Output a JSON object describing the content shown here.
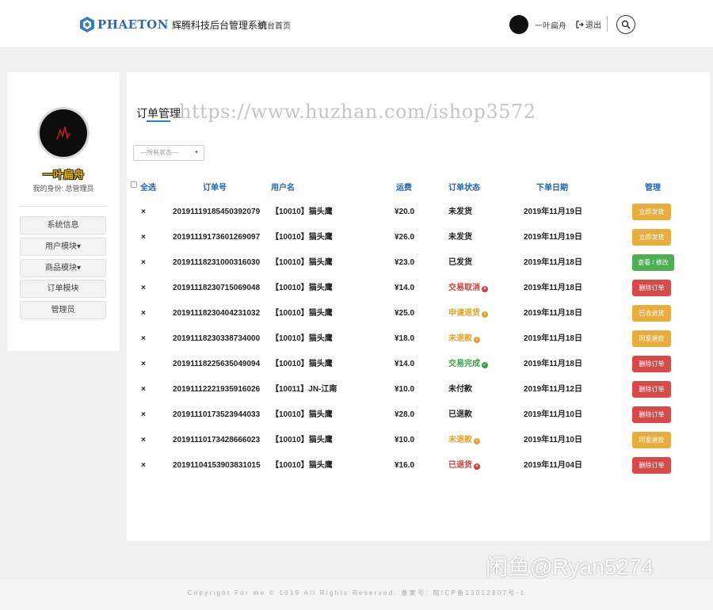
{
  "header": {
    "brand": "PHAETON",
    "system_name": "辉腾科技后台管理系统",
    "nav_home": "前台首页",
    "username": "一叶扁舟",
    "logout": "退出"
  },
  "sidebar": {
    "name": "一叶扁舟",
    "role": "我的身份: 总管理员",
    "items": [
      {
        "label": "系统信息"
      },
      {
        "label": "用户模块▾"
      },
      {
        "label": "商品模块▾"
      },
      {
        "label": "订单模块"
      },
      {
        "label": "管理员"
      }
    ]
  },
  "main": {
    "title": "订单管理",
    "watermark": "https://www.huzhan.com/ishop3572",
    "status_select": "—所有状态—",
    "columns": {
      "select_all": "全选",
      "order_no": "订单号",
      "user": "用户名",
      "shipping": "运费",
      "status": "订单状态",
      "date": "下单日期",
      "manage": "管理"
    },
    "rows": [
      {
        "del": "×",
        "order_no": "20191119185450392079",
        "user": "【10010】猫头鹰",
        "shipping": "¥20.0",
        "status": "未发货",
        "status_color": "#222222",
        "status_icon": "",
        "date": "2019年11月19日",
        "action": "立即发货",
        "action_type": "orange"
      },
      {
        "del": "×",
        "order_no": "20191119173601269097",
        "user": "【10010】猫头鹰",
        "shipping": "¥26.0",
        "status": "未发货",
        "status_color": "#222222",
        "status_icon": "",
        "date": "2019年11月19日",
        "action": "立即发货",
        "action_type": "orange"
      },
      {
        "del": "×",
        "order_no": "20191118231000316030",
        "user": "【10010】猫头鹰",
        "shipping": "¥23.0",
        "status": "已发货",
        "status_color": "#222222",
        "status_icon": "",
        "date": "2019年11月18日",
        "action": "查看 / 修改",
        "action_type": "green"
      },
      {
        "del": "×",
        "order_no": "20191118230715069048",
        "user": "【10010】猫头鹰",
        "shipping": "¥14.0",
        "status": "交易取消",
        "status_color": "#c9403d",
        "status_icon": "x",
        "date": "2019年11月18日",
        "action": "删除订单",
        "action_type": "red"
      },
      {
        "del": "×",
        "order_no": "20191118230404231032",
        "user": "【10010】猫头鹰",
        "shipping": "¥25.0",
        "status": "申请退货",
        "status_color": "#e0a032",
        "status_icon": "i",
        "date": "2019年11月18日",
        "action": "已收退货",
        "action_type": "orange"
      },
      {
        "del": "×",
        "order_no": "20191118230338734000",
        "user": "【10010】猫头鹰",
        "shipping": "¥18.0",
        "status": "未退款",
        "status_color": "#e0a032",
        "status_icon": "i",
        "date": "2019年11月18日",
        "action": "同意退款",
        "action_type": "orange"
      },
      {
        "del": "×",
        "order_no": "20191118225635049094",
        "user": "【10010】猫头鹰",
        "shipping": "¥14.0",
        "status": "交易完成",
        "status_color": "#3e9c45",
        "status_icon": "check",
        "date": "2019年11月18日",
        "action": "删除订单",
        "action_type": "red"
      },
      {
        "del": "×",
        "order_no": "20191112221935916026",
        "user": "【10011】JN-江南",
        "shipping": "¥10.0",
        "status": "未付款",
        "status_color": "#222222",
        "status_icon": "",
        "date": "2019年11月12日",
        "action": "删除订单",
        "action_type": "red"
      },
      {
        "del": "×",
        "order_no": "20191110173523944033",
        "user": "【10010】猫头鹰",
        "shipping": "¥28.0",
        "status": "已退款",
        "status_color": "#222222",
        "status_icon": "",
        "date": "2019年11月10日",
        "action": "删除订单",
        "action_type": "red"
      },
      {
        "del": "×",
        "order_no": "20191110173428666023",
        "user": "【10010】猫头鹰",
        "shipping": "¥10.0",
        "status": "未退款",
        "status_color": "#e0a032",
        "status_icon": "i",
        "date": "2019年11月10日",
        "action": "同意退款",
        "action_type": "orange"
      },
      {
        "del": "×",
        "order_no": "20191104153903831015",
        "user": "【10010】猫头鹰",
        "shipping": "¥16.0",
        "status": "已退货",
        "status_color": "#c9403d",
        "status_icon": "x",
        "date": "2019年11月04日",
        "action": "删除订单",
        "action_type": "red"
      }
    ]
  },
  "footer": {
    "copyright": "Copyright For me © 1019 All Rights Reserved. 备案号: 皖ICP备13012807号-1",
    "overlay": "闲鱼@Ryan5274"
  }
}
